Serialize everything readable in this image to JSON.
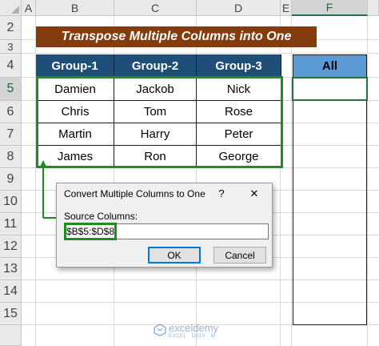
{
  "columns": [
    "A",
    "B",
    "C",
    "D",
    "E",
    "F"
  ],
  "rows": [
    "2",
    "3",
    "4",
    "5",
    "6",
    "7",
    "8",
    "9",
    "10",
    "11",
    "12",
    "13",
    "14",
    "15"
  ],
  "title": "Transpose Multiple Columns into One",
  "table": {
    "headers": [
      "Group-1",
      "Group-2",
      "Group-3"
    ],
    "rows": [
      [
        "Damien",
        "Jackob",
        "Nick"
      ],
      [
        "Chris",
        "Tom",
        "Rose"
      ],
      [
        "Martin",
        "Harry",
        "Peter"
      ],
      [
        "James",
        "Ron",
        "George"
      ]
    ]
  },
  "output": {
    "header": "All"
  },
  "dialog": {
    "title": "Convert Multiple Columns to One",
    "help": "?",
    "close": "✕",
    "label": "Source Columns:",
    "value": "$B$5:$D$8",
    "ok": "OK",
    "cancel": "Cancel"
  },
  "watermark": {
    "name": "exceldemy",
    "tagline": "EXCEL · DATA · BI"
  },
  "colors": {
    "title_bg": "#843c0c",
    "header_bg": "#1f4e79",
    "output_header_bg": "#5b9bd5",
    "highlight": "#1e8c1e"
  }
}
